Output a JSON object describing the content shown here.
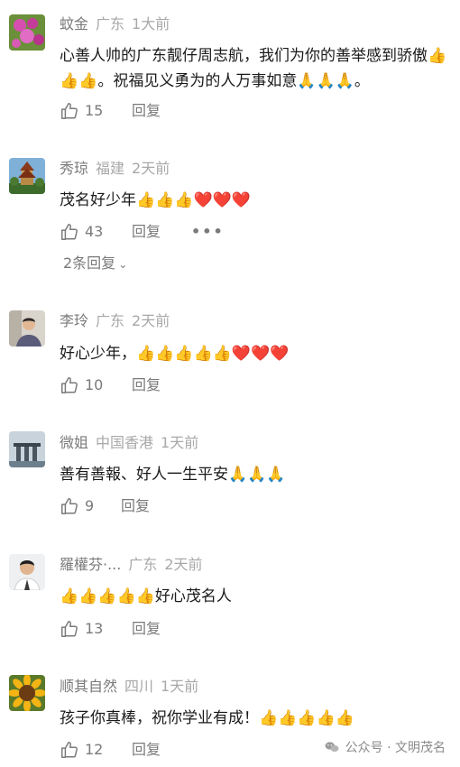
{
  "comments": [
    {
      "nickname": "蚊金",
      "location": "广东",
      "time": "1大前",
      "text": "心善人帅的广东靓仔周志航，我们为你的善举感到骄傲👍👍👍。祝福见义勇为的人万事如意🙏🙏🙏。",
      "likes": "15",
      "reply_label": "回复",
      "avatar": "flower-avatar-icon"
    },
    {
      "nickname": "秀琼",
      "location": "福建",
      "time": "2天前",
      "text": "茂名好少年👍👍👍❤️❤️❤️",
      "likes": "43",
      "reply_label": "回复",
      "more_label": "•••",
      "sub_replies": "2条回复",
      "avatar": "tower-avatar-icon"
    },
    {
      "nickname": "李玲",
      "location": "广东",
      "time": "2天前",
      "text": "好心少年，👍👍👍👍👍❤️❤️❤️",
      "likes": "10",
      "reply_label": "回复",
      "avatar": "person-avatar-icon"
    },
    {
      "nickname": "微姐",
      "location": "中国香港",
      "time": "1天前",
      "text": "善有善報、好人一生平安🙏🙏🙏",
      "likes": "9",
      "reply_label": "回复",
      "avatar": "skyline-avatar-icon"
    },
    {
      "nickname": "羅權芬·...",
      "location": "广东",
      "time": "2天前",
      "text": "👍👍👍👍👍好心茂名人",
      "likes": "13",
      "reply_label": "回复",
      "avatar": "man-avatar-icon"
    },
    {
      "nickname": "顺其自然",
      "location": "四川",
      "time": "1天前",
      "text": "孩子你真棒，祝你学业有成！👍👍👍👍👍",
      "likes": "12",
      "reply_label": "回复",
      "avatar": "sunflower-avatar-icon"
    }
  ],
  "watermark": {
    "text": "公众号 · 文明茂名"
  },
  "colors": {
    "nickname": "#7a7a7a",
    "meta": "#a8a8a8",
    "text": "#1a1a1a",
    "action": "#7a7a7a"
  }
}
